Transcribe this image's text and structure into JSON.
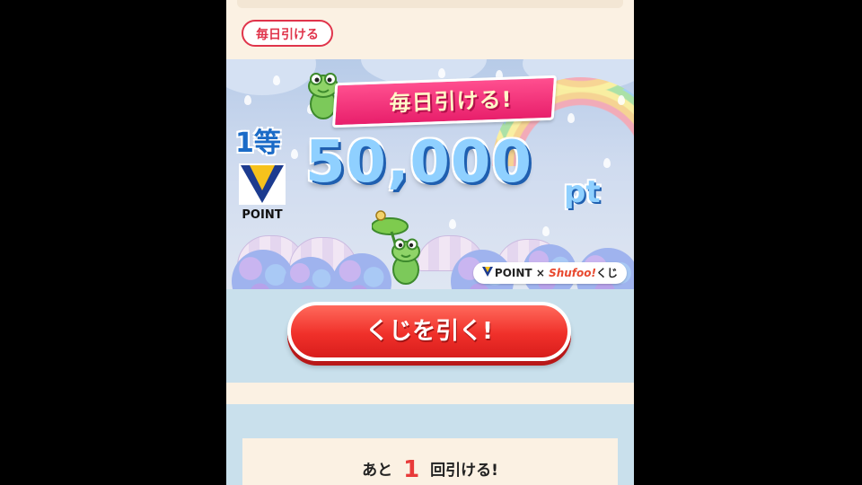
{
  "tag": {
    "label": "毎日引ける"
  },
  "banner": {
    "ribbon": "毎日引ける!",
    "first_prize": "1等",
    "points_logo": "POINT",
    "amount": "50,000",
    "unit": "pt",
    "collab": {
      "brand_a": "POINT",
      "separator": "×",
      "brand_b": "Shufoo!",
      "brand_b_suffix": "くじ"
    }
  },
  "draw_button": {
    "label": "くじを引く!"
  },
  "remaining": {
    "prefix": "あと",
    "count": "1",
    "suffix": "回引ける!"
  },
  "colors": {
    "accent_red": "#e0344b",
    "button_red": "#f0302a",
    "panel_blue": "#c9e0ec",
    "cream": "#fbf1e3"
  }
}
